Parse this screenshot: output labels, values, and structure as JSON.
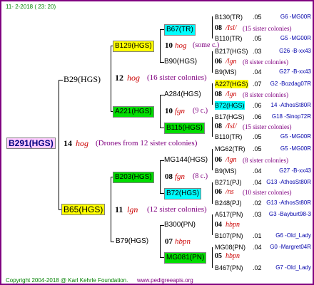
{
  "header": {
    "date": "11-  2-2018 ( 23: 20)"
  },
  "footer": {
    "copyright": "Copyright 2004-2018 @ Karl Kehrle Foundation.",
    "site": "www.pedigreeapis.org"
  },
  "root": {
    "id": "B291(HGS)",
    "num": "14",
    "mating": "hog",
    "note": "(Drones from 12 sister colonies)"
  },
  "gen1": {
    "b29": {
      "id": "B29(HGS)",
      "num": "12",
      "mating": "hog",
      "note": "(16 sister colonies)"
    },
    "b65": {
      "id": "B65(HGS)",
      "num": "11",
      "mating": "lgn",
      "note": "(12 sister colonies)"
    }
  },
  "gen2": {
    "b129": {
      "id": "B129(HGS)",
      "num": "10",
      "mating": "hog",
      "note": "(some c.)"
    },
    "b90": {
      "id": "B90(HGS)"
    },
    "a221": {
      "id": "A221(HGS)",
      "num": "10",
      "mating": "fgn",
      "note": "(9 c.)"
    },
    "a284": {
      "id": "A284(HGS)"
    },
    "b203": {
      "id": "B203(HGS)",
      "num": "08",
      "mating": "fgn",
      "note": "(8 c.)"
    },
    "mg144": {
      "id": "MG144(HGS)"
    },
    "b79": {
      "id": "B79(HGS)",
      "num": "07",
      "mating": "hbpn"
    },
    "b300": {
      "id": "B300(PN)"
    }
  },
  "gen3": {
    "b67": {
      "id": "B67(TR)"
    },
    "b115": {
      "id": "B115(HGS)"
    },
    "b72": {
      "id": "B72(HGS)"
    },
    "mg081": {
      "id": "MG081(PN)"
    }
  },
  "right": [
    {
      "id": "B130(TR)",
      "n": ".05",
      "src": "G6 -MG00R",
      "kind": "ref"
    },
    {
      "num": "08",
      "mate": "/Isl/",
      "note": "(15 sister colonies)",
      "kind": "mate"
    },
    {
      "id": "B110(TR)",
      "n": ".05",
      "src": "G5 -MG00R",
      "kind": "ref"
    },
    {
      "id": "B217(HGS)",
      "n": ".03",
      "src": "G26 -B-xx43",
      "kind": "ref"
    },
    {
      "num": "06",
      "mate": "/lgn",
      "note": "(8 sister colonies)",
      "kind": "mate"
    },
    {
      "id": "B9(MS)",
      "n": ".04",
      "src": "G27 -B-xx43",
      "kind": "ref"
    },
    {
      "id": "A227(HGS)",
      "n": ".07",
      "src": "G2 -Bozdag07R",
      "kind": "ref"
    },
    {
      "num": "08",
      "mate": "/lgn",
      "note": "(8 sister colonies)",
      "kind": "mate"
    },
    {
      "id": "B72(HGS)",
      "n": ".06",
      "src": "14 -AthosSt80R",
      "kind": "ref"
    },
    {
      "id": "B17(HGS)",
      "n": ".06",
      "src": "G18 -Sinop72R",
      "kind": "ref"
    },
    {
      "num": "08",
      "mate": "/Isl/",
      "note": "(15 sister colonies)",
      "kind": "mate"
    },
    {
      "id": "B110(TR)",
      "n": ".05",
      "src": "G5 -MG00R",
      "kind": "ref"
    },
    {
      "id": "MG62(TR)",
      "n": ".05",
      "src": "G5 -MG00R",
      "kind": "ref"
    },
    {
      "num": "06",
      "mate": "/lgn",
      "note": "(8 sister colonies)",
      "kind": "mate"
    },
    {
      "id": "B9(MS)",
      "n": ".04",
      "src": "G27 -B-xx43",
      "kind": "ref"
    },
    {
      "id": "B271(PJ)",
      "n": ".04",
      "src": "G13 -AthosSt80R",
      "kind": "ref"
    },
    {
      "num": "06",
      "mate": "/ns",
      "note": "(10 sister colonies)",
      "kind": "mate"
    },
    {
      "id": "B248(PJ)",
      "n": ".02",
      "src": "G13 -AthosSt80R",
      "kind": "ref"
    },
    {
      "id": "A517(PN)",
      "n": ".03",
      "src": "G3 -Bayburt98-3",
      "kind": "ref"
    },
    {
      "num": "04",
      "mate": "hbpn",
      "note": "",
      "kind": "mate"
    },
    {
      "id": "B107(PN)",
      "n": ".01",
      "src": "G6 -Old_Lady",
      "kind": "ref"
    },
    {
      "id": "MG08(PN)",
      "n": ".04",
      "src": "G0 -Margret04R",
      "kind": "ref"
    },
    {
      "num": "05",
      "mate": "hbpn",
      "note": "",
      "kind": "mate"
    },
    {
      "id": "B467(PN)",
      "n": ".02",
      "src": "G7 -Old_Lady",
      "kind": "ref"
    }
  ]
}
